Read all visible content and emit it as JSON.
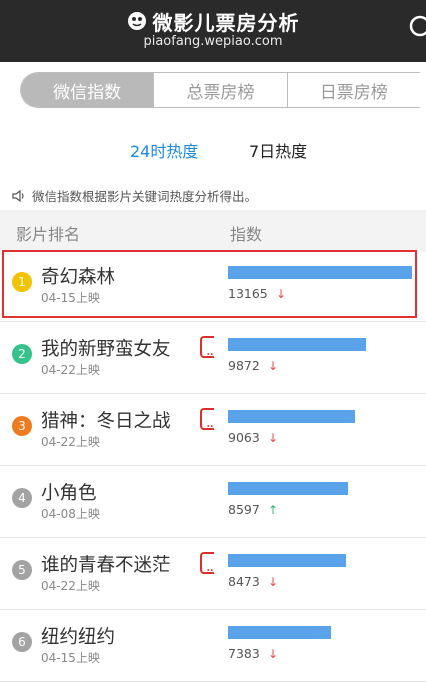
{
  "header": {
    "title": "微影儿票房分析",
    "url": "piaofang.wepiao.com"
  },
  "tabs": [
    {
      "label": "微信指数",
      "active": true
    },
    {
      "label": "总票房榜",
      "active": false
    },
    {
      "label": "日票房榜",
      "active": false
    }
  ],
  "subtabs": [
    {
      "label": "24时热度",
      "active": true
    },
    {
      "label": "7日热度",
      "active": false
    }
  ],
  "note": "微信指数根据影片关键词热度分析得出。",
  "columns": {
    "rank": "影片排名",
    "index": "指数"
  },
  "movies": [
    {
      "rank": "1",
      "title": "奇幻森林",
      "date": "04-15上映",
      "value": "13165",
      "trend": "down",
      "bar_pct": 100,
      "color": "#f2c300",
      "truncated": false,
      "highlighted": true
    },
    {
      "rank": "2",
      "title": "我的新野蛮女友",
      "date": "04-22上映",
      "value": "9872",
      "trend": "down",
      "bar_pct": 75,
      "color": "#35c28c",
      "truncated": true,
      "highlighted": false
    },
    {
      "rank": "3",
      "title": "猎神：冬日之战",
      "date": "04-22上映",
      "value": "9063",
      "trend": "down",
      "bar_pct": 68.8,
      "color": "#f07b1f",
      "truncated": true,
      "highlighted": false
    },
    {
      "rank": "4",
      "title": "小角色",
      "date": "04-08上映",
      "value": "8597",
      "trend": "up",
      "bar_pct": 65.3,
      "color": "#a3a3a3",
      "truncated": false,
      "highlighted": false
    },
    {
      "rank": "5",
      "title": "谁的青春不迷茫",
      "date": "04-22上映",
      "value": "8473",
      "trend": "down",
      "bar_pct": 64.4,
      "color": "#a3a3a3",
      "truncated": true,
      "highlighted": false
    },
    {
      "rank": "6",
      "title": "纽约纽约",
      "date": "04-15上映",
      "value": "7383",
      "trend": "down",
      "bar_pct": 56.1,
      "color": "#a3a3a3",
      "truncated": false,
      "highlighted": false
    }
  ],
  "colors": {
    "accent": "#1a8be0",
    "bar": "#5aa3ea",
    "down": "#e24b4b",
    "up": "#39b07a",
    "highlight": "#e03232"
  },
  "icons": {
    "logo": "logo-mark-icon",
    "search": "search-icon",
    "speaker": "speaker-icon"
  }
}
